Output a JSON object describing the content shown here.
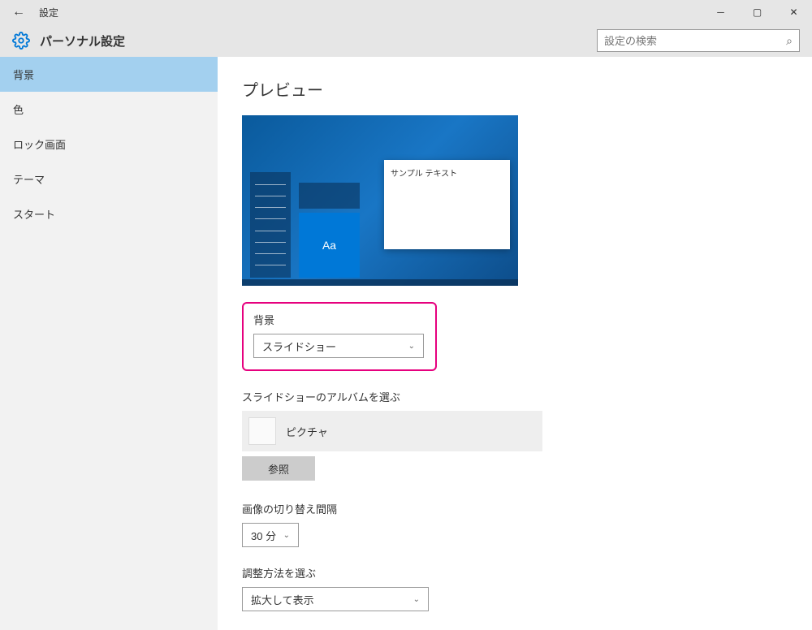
{
  "titlebar": {
    "title": "設定"
  },
  "header": {
    "title": "パーソナル設定",
    "search_placeholder": "設定の検索"
  },
  "sidebar": {
    "items": [
      {
        "label": "背景",
        "selected": true
      },
      {
        "label": "色",
        "selected": false
      },
      {
        "label": "ロック画面",
        "selected": false
      },
      {
        "label": "テーマ",
        "selected": false
      },
      {
        "label": "スタート",
        "selected": false
      }
    ]
  },
  "content": {
    "preview_heading": "プレビュー",
    "preview_tile_text": "Aa",
    "preview_window_text": "サンプル テキスト",
    "background_label": "背景",
    "background_value": "スライドショー",
    "album_label": "スライドショーのアルバムを選ぶ",
    "album_name": "ピクチャ",
    "browse_label": "参照",
    "interval_label": "画像の切り替え間隔",
    "interval_value": "30 分",
    "fit_label": "調整方法を選ぶ",
    "fit_value": "拡大して表示"
  }
}
